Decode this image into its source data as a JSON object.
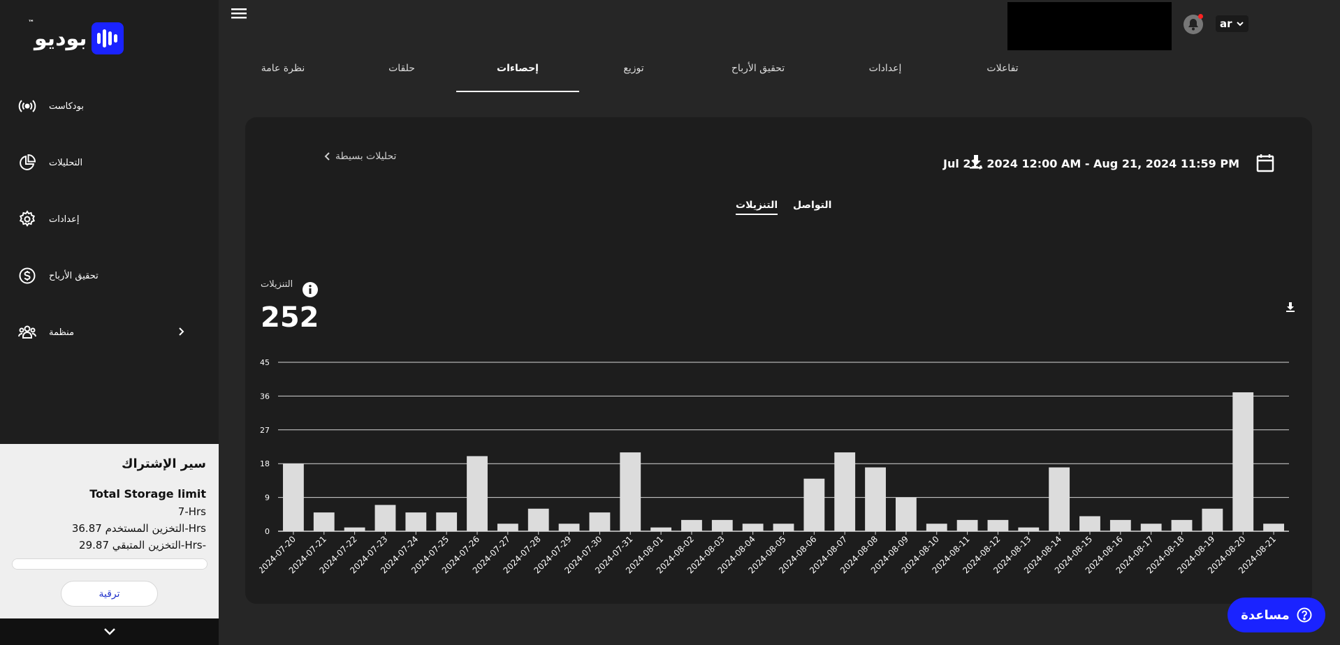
{
  "sidebar": {
    "logo": "بوديو",
    "logo_tm": "™",
    "items": [
      {
        "label": "بودكاست",
        "icon": "podcast-icon"
      },
      {
        "label": "التحليلات",
        "icon": "pie-chart-icon"
      },
      {
        "label": "إعدادات",
        "icon": "gear-icon"
      },
      {
        "label": "تحقيق الأرباح",
        "icon": "dollar-icon"
      },
      {
        "label": "منظمة",
        "icon": "users-icon"
      }
    ],
    "subscription": {
      "title": "سير الإشتراك",
      "limit_label": "Total Storage limit",
      "limit_value": "7-Hrs",
      "used": "التخزين المستخدم 36.87-Hrs",
      "remaining": "التخزين المتبقي 29.87-Hrs-",
      "upgrade_label": "ترقية"
    }
  },
  "header": {
    "language": "ar"
  },
  "tabs": [
    {
      "label": "تفاعلات",
      "active": false
    },
    {
      "label": "إعدادات",
      "active": false
    },
    {
      "label": "تحقيق الأرباح",
      "active": false
    },
    {
      "label": "توزيع",
      "active": false
    },
    {
      "label": "إحصاءات",
      "active": true
    },
    {
      "label": "حلقات",
      "active": false
    },
    {
      "label": "نظرة عامة",
      "active": false
    }
  ],
  "analytics": {
    "date_range": "Jul 21, 2024 12:00 AM - Aug 21, 2024 11:59 PM",
    "back_link": "تحليلات بسيطة",
    "sub_tabs": [
      {
        "label": "التواصل",
        "active": false
      },
      {
        "label": "التنزيلات",
        "active": true
      }
    ],
    "metric_label": "التنزيلات",
    "metric_value": "252"
  },
  "chart_data": {
    "type": "bar",
    "categories": [
      "2024-07-20",
      "2024-07-21",
      "2024-07-22",
      "2024-07-23",
      "2024-07-24",
      "2024-07-25",
      "2024-07-26",
      "2024-07-27",
      "2024-07-28",
      "2024-07-29",
      "2024-07-30",
      "2024-07-31",
      "2024-08-01",
      "2024-08-02",
      "2024-08-03",
      "2024-08-04",
      "2024-08-05",
      "2024-08-06",
      "2024-08-07",
      "2024-08-08",
      "2024-08-09",
      "2024-08-10",
      "2024-08-11",
      "2024-08-12",
      "2024-08-13",
      "2024-08-14",
      "2024-08-15",
      "2024-08-16",
      "2024-08-17",
      "2024-08-18",
      "2024-08-19",
      "2024-08-20",
      "2024-08-21"
    ],
    "values": [
      18,
      5,
      1,
      7,
      5,
      5,
      20,
      2,
      6,
      2,
      5,
      21,
      1,
      3,
      3,
      2,
      2,
      14,
      21,
      17,
      9,
      2,
      3,
      3,
      1,
      17,
      4,
      3,
      2,
      3,
      6,
      37,
      2
    ],
    "yticks": [
      0,
      9,
      18,
      27,
      36,
      45
    ],
    "ylim": [
      0,
      45
    ],
    "grid": true,
    "bar_color": "#dcdcdc"
  },
  "help": {
    "label": "مساعدة"
  }
}
